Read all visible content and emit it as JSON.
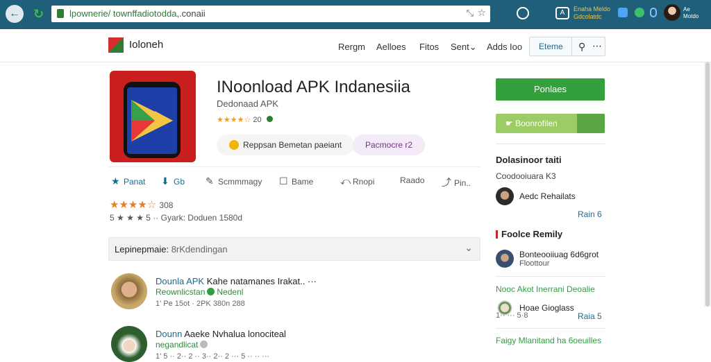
{
  "browser": {
    "url_prefix": "lpownerie/ townffadiotodda",
    "url_rest": ",.conaii",
    "ext_label_1": "Enaha Meldo",
    "ext_label_2": "Gdcolatdc",
    "account": "Ae\nMotdo"
  },
  "site": {
    "brand": "Ioloneh",
    "nav": [
      "Rergm",
      "Aelloes",
      "Fitos",
      "Sent",
      "Adds",
      "Ioo"
    ],
    "search_label": "Eteme"
  },
  "app": {
    "title": "INoonload APK Indanesiia",
    "subtitle": "Dedonaad APK",
    "rating_small": "★★★★☆",
    "rating_small_count": "20",
    "chip_left": "Reppsan Bemetan paeiant",
    "chip_right": "Pacmocre r2"
  },
  "actions": [
    {
      "icon": "★",
      "label": "Panat",
      "primary": true
    },
    {
      "icon": "⬇",
      "label": "Gb",
      "primary": true
    },
    {
      "icon": "✎",
      "label": "Scmmmagy",
      "primary": false
    },
    {
      "icon": "☐",
      "label": "Bame",
      "primary": false
    },
    {
      "icon": "⤺",
      "label": "Rnopi",
      "primary": false
    },
    {
      "icon": "",
      "label": "Raado",
      "primary": false
    },
    {
      "icon": "⤴",
      "label": "Pin..",
      "primary": false
    }
  ],
  "rating": {
    "stars": "★★★★☆",
    "count": "308",
    "meta": "5 ★ ★ ★ 5 ·· Gyark: Doduen 1580d"
  },
  "dropdown": {
    "label": "Lepinepmaie:",
    "value": "8rKdendingan"
  },
  "reviews": [
    {
      "name_blue": "Dounla APK",
      "name_rest": "Kahe natamanes Irakat..",
      "sub": "Reownlicstan",
      "sub_tail": "Nedenl",
      "meta": "1' Pe  15ot · 2PK 380n 288"
    },
    {
      "name_blue": "Dounn",
      "name_rest": "Aaeke Nvhalua lonociteal",
      "sub": "negandlicat",
      "sub_tail": "",
      "meta": "1' 5 ·· 2·· 2 ·· 3·· 2·· 2 ··· 5 ·· ·· ···"
    }
  ],
  "sidebar": {
    "primary_button": "Ponlaes",
    "secondary_button": "Boonrofilen",
    "section1_title": "Dolasinoor taiti",
    "section1_text": "Coodooiuara K3",
    "person1": "Aedc Rehailats",
    "link1": "Rain 6",
    "section2_title": "Foolce Remily",
    "person2_line1": "Bonteooiiuag 6d6grot",
    "person2_line2": "Floottour",
    "green1": "Nooc Akot Inerrani Deoalie",
    "person3": "Hoae Gioglass",
    "meta3": "1·· ··· 5·8",
    "link2": "Raia 5",
    "green2": "Faigy Mlanitand ha 6oeuilles"
  }
}
